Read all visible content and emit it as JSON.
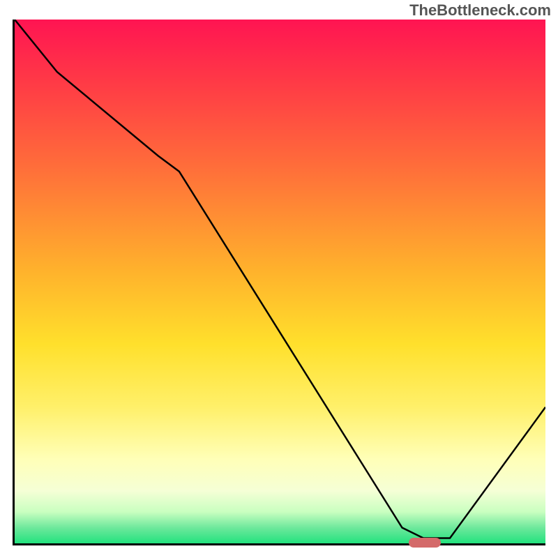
{
  "watermark": "TheBottleneck.com",
  "chart_data": {
    "type": "line",
    "title": "",
    "xlabel": "",
    "ylabel": "",
    "xlim": [
      0,
      100
    ],
    "ylim": [
      0,
      100
    ],
    "x": [
      0,
      8,
      27,
      31,
      73,
      77,
      82,
      100
    ],
    "values": [
      100,
      90,
      74,
      71,
      3,
      1,
      1,
      26
    ],
    "marker": {
      "x": 77,
      "y": 0.5
    },
    "grid": false,
    "legend": false
  }
}
